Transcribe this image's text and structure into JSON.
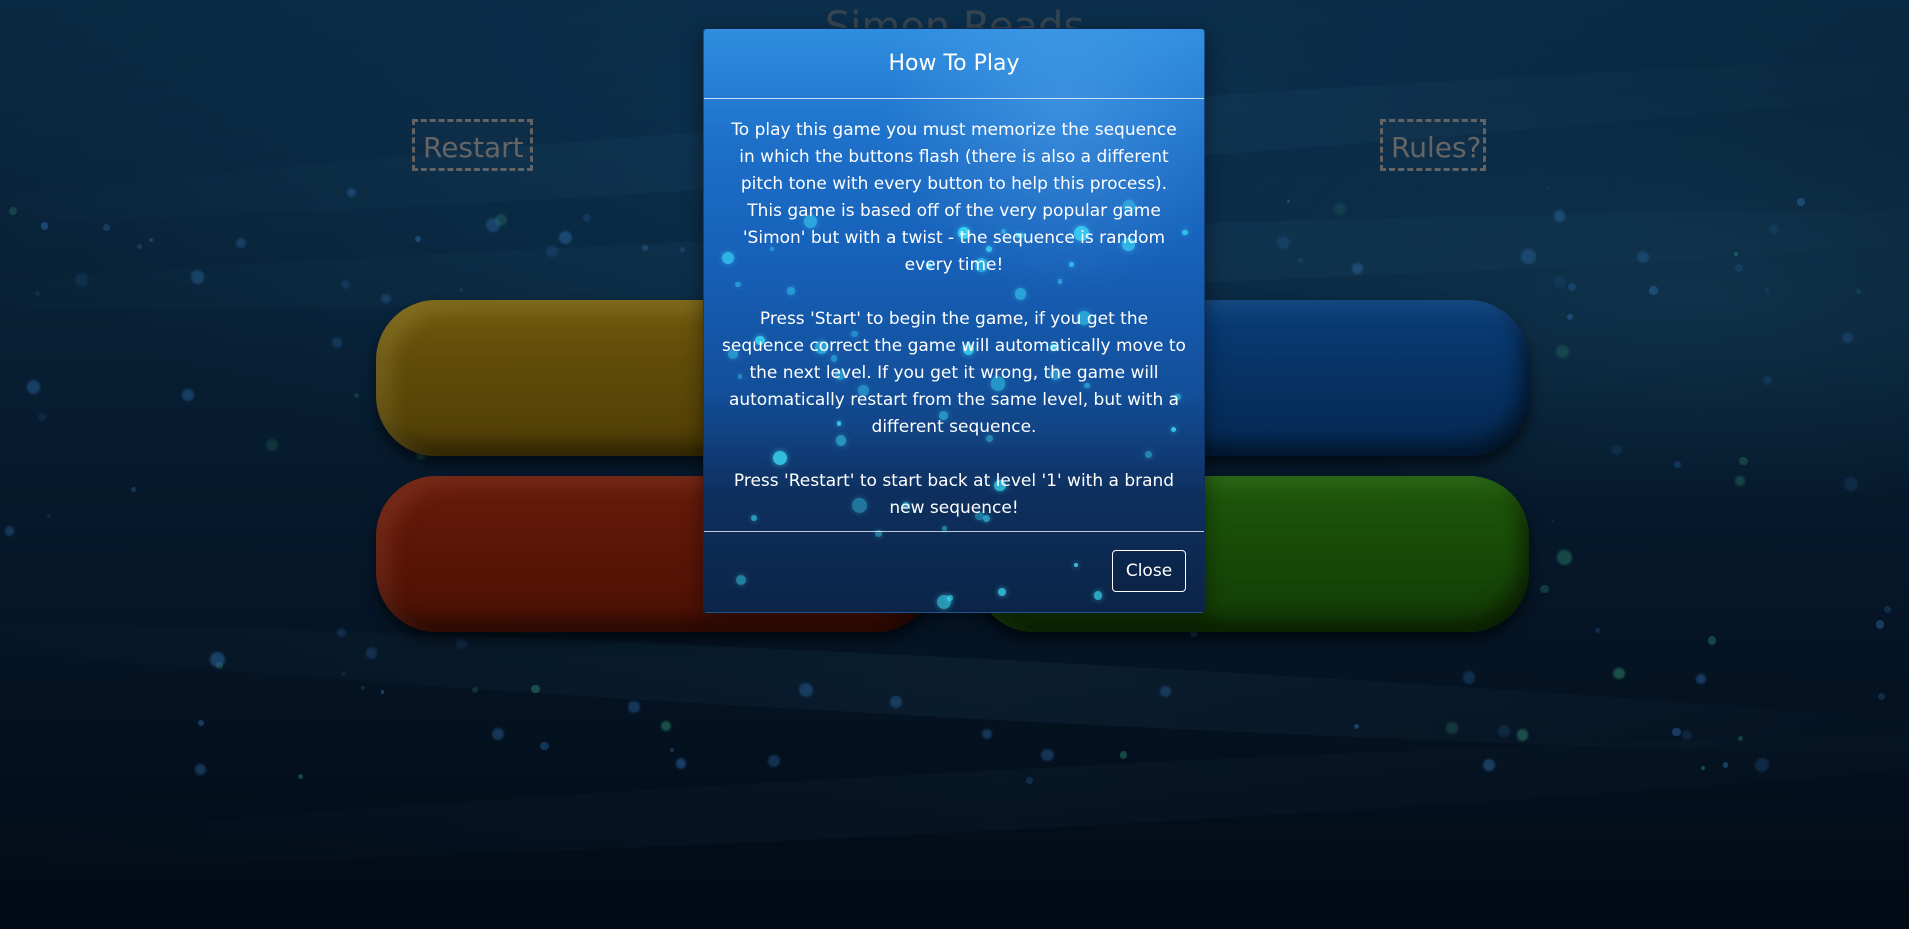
{
  "game": {
    "title": "Simon Reads",
    "restart_label": "Restart",
    "rules_label": "Rules?",
    "pads": [
      {
        "name": "yellow",
        "color": "#86690d"
      },
      {
        "name": "blue",
        "color": "#0a478c"
      },
      {
        "name": "red",
        "color": "#7e1f0b"
      },
      {
        "name": "green",
        "color": "#23690b"
      }
    ]
  },
  "modal": {
    "title": "How To Play",
    "paragraphs": [
      "To play this game you must memorize the sequence in which the buttons flash (there is also a different pitch tone with every button to help this process). This game is based off of the very popular game 'Simon' but with a twist - the sequence is random every time!",
      "Press 'Start' to begin the game, if you get the sequence correct the game will automatically move to the next level. If you get it wrong, the game will automatically restart from the same level, but with a different sequence.",
      "Press 'Restart' to start back at level '1' with a brand new sequence!"
    ],
    "close_label": "Close"
  },
  "colors": {
    "background": "#0c2f4c",
    "modal_top": "#2f8ee0",
    "modal_bottom": "#0b2447",
    "text": "#ffffff"
  }
}
